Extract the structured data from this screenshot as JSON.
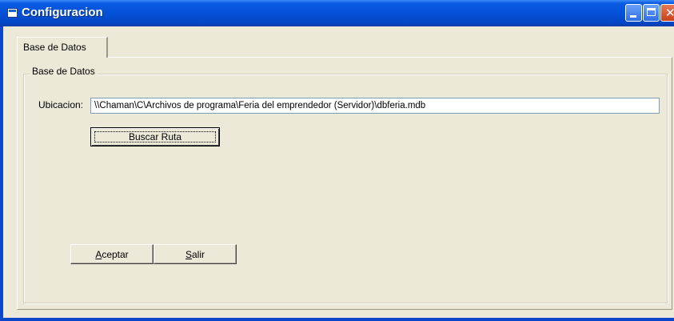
{
  "window": {
    "title": "Configuracion",
    "controls": {
      "minimize_icon": "minimize-icon",
      "maximize_icon": "maximize-icon",
      "close_icon": "close-icon",
      "close_glyph": "✕"
    }
  },
  "tabs": [
    {
      "label": "Base de Datos",
      "selected": true
    }
  ],
  "group": {
    "caption": "Base de Datos",
    "location_label": "Ubicacion:",
    "location_value": "\\\\Chaman\\C\\Archivos de programa\\Feria del emprendedor (Servidor)\\dbferia.mdb",
    "browse_button": "Buscar Ruta"
  },
  "buttons": {
    "accept_prefix": "A",
    "accept_rest": "ceptar",
    "exit_prefix": "S",
    "exit_rest": "alir"
  },
  "colors": {
    "titlebar": "#0451d6",
    "face": "#ece9d8",
    "input_border": "#7f9db9"
  }
}
